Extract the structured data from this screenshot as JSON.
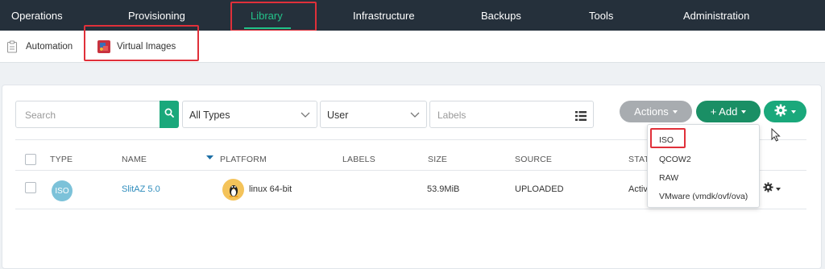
{
  "topnav": {
    "items": [
      {
        "label": "Operations"
      },
      {
        "label": "Provisioning"
      },
      {
        "label": "Library"
      },
      {
        "label": "Infrastructure"
      },
      {
        "label": "Backups"
      },
      {
        "label": "Tools"
      },
      {
        "label": "Administration"
      }
    ],
    "active": "Library",
    "accent": "#23c38a",
    "background": "#25303b"
  },
  "subnav": {
    "items": [
      {
        "label": "Automation",
        "icon": "clipboard-icon"
      },
      {
        "label": "Virtual Images",
        "icon": "virtual-image-icon"
      }
    ],
    "active": "Virtual Images"
  },
  "filters": {
    "search_placeholder": "Search",
    "type_select": "All Types",
    "owner_select": "User",
    "labels_placeholder": "Labels"
  },
  "toolbar": {
    "actions_label": "Actions",
    "add_label": "+ Add",
    "gear_icon": "gear-icon"
  },
  "add_menu": {
    "items": [
      {
        "label": "ISO"
      },
      {
        "label": "QCOW2"
      },
      {
        "label": "RAW"
      },
      {
        "label": "VMware (vmdk/ovf/ova)"
      }
    ],
    "highlighted": "ISO"
  },
  "table": {
    "columns": [
      "TYPE",
      "NAME",
      "PLATFORM",
      "LABELS",
      "SIZE",
      "SOURCE",
      "STAT"
    ],
    "sorted_column": "PLATFORM",
    "rows": [
      {
        "type": "ISO",
        "name": "SlitAZ 5.0",
        "platform": "linux 64-bit",
        "labels": "",
        "size": "53.9MiB",
        "source": "UPLOADED",
        "status": "Active"
      }
    ]
  },
  "colors": {
    "primary_green": "#1a8f65",
    "light_green": "#1aa87b",
    "highlight_red": "#e0303a",
    "link_blue": "#2f8dbd"
  }
}
